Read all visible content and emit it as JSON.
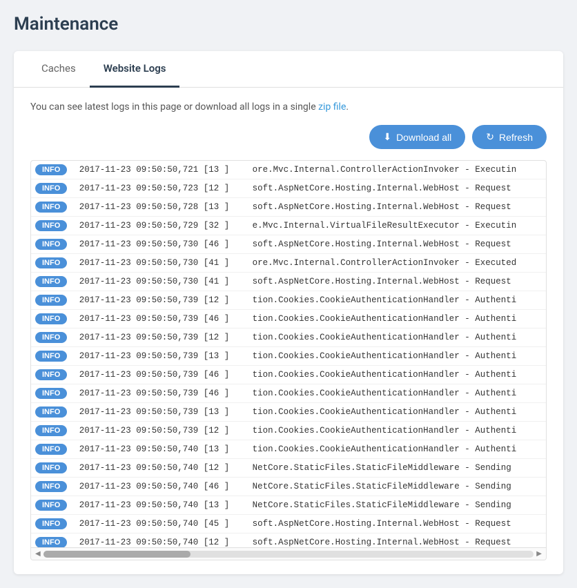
{
  "page": {
    "title": "Maintenance"
  },
  "tabs": [
    {
      "id": "caches",
      "label": "Caches",
      "active": false
    },
    {
      "id": "website-logs",
      "label": "Website Logs",
      "active": true
    }
  ],
  "info_text": "You can see latest logs in this page or download all logs in a single zip file.",
  "info_link": "zip file",
  "toolbar": {
    "download_all_label": "Download all",
    "refresh_label": "Refresh"
  },
  "logs": [
    {
      "level": "INFO",
      "timestamp": "2017-11-23 09:50:50,721",
      "thread": "[13 ]",
      "message": "ore.Mvc.Internal.ControllerActionInvoker - Executin"
    },
    {
      "level": "INFO",
      "timestamp": "2017-11-23 09:50:50,723",
      "thread": "[12 ]",
      "message": "soft.AspNetCore.Hosting.Internal.WebHost - Request"
    },
    {
      "level": "INFO",
      "timestamp": "2017-11-23 09:50:50,728",
      "thread": "[13 ]",
      "message": "soft.AspNetCore.Hosting.Internal.WebHost - Request"
    },
    {
      "level": "INFO",
      "timestamp": "2017-11-23 09:50:50,729",
      "thread": "[32 ]",
      "message": "e.Mvc.Internal.VirtualFileResultExecutor - Executin"
    },
    {
      "level": "INFO",
      "timestamp": "2017-11-23 09:50:50,730",
      "thread": "[46 ]",
      "message": "soft.AspNetCore.Hosting.Internal.WebHost - Request"
    },
    {
      "level": "INFO",
      "timestamp": "2017-11-23 09:50:50,730",
      "thread": "[41 ]",
      "message": "ore.Mvc.Internal.ControllerActionInvoker - Executed"
    },
    {
      "level": "INFO",
      "timestamp": "2017-11-23 09:50:50,730",
      "thread": "[41 ]",
      "message": "soft.AspNetCore.Hosting.Internal.WebHost - Request"
    },
    {
      "level": "INFO",
      "timestamp": "2017-11-23 09:50:50,739",
      "thread": "[12 ]",
      "message": "tion.Cookies.CookieAuthenticationHandler - Authenti"
    },
    {
      "level": "INFO",
      "timestamp": "2017-11-23 09:50:50,739",
      "thread": "[46 ]",
      "message": "tion.Cookies.CookieAuthenticationHandler - Authenti"
    },
    {
      "level": "INFO",
      "timestamp": "2017-11-23 09:50:50,739",
      "thread": "[12 ]",
      "message": "tion.Cookies.CookieAuthenticationHandler - Authenti"
    },
    {
      "level": "INFO",
      "timestamp": "2017-11-23 09:50:50,739",
      "thread": "[13 ]",
      "message": "tion.Cookies.CookieAuthenticationHandler - Authenti"
    },
    {
      "level": "INFO",
      "timestamp": "2017-11-23 09:50:50,739",
      "thread": "[46 ]",
      "message": "tion.Cookies.CookieAuthenticationHandler - Authenti"
    },
    {
      "level": "INFO",
      "timestamp": "2017-11-23 09:50:50,739",
      "thread": "[46 ]",
      "message": "tion.Cookies.CookieAuthenticationHandler - Authenti"
    },
    {
      "level": "INFO",
      "timestamp": "2017-11-23 09:50:50,739",
      "thread": "[13 ]",
      "message": "tion.Cookies.CookieAuthenticationHandler - Authenti"
    },
    {
      "level": "INFO",
      "timestamp": "2017-11-23 09:50:50,739",
      "thread": "[12 ]",
      "message": "tion.Cookies.CookieAuthenticationHandler - Authenti"
    },
    {
      "level": "INFO",
      "timestamp": "2017-11-23 09:50:50,740",
      "thread": "[13 ]",
      "message": "tion.Cookies.CookieAuthenticationHandler - Authenti"
    },
    {
      "level": "INFO",
      "timestamp": "2017-11-23 09:50:50,740",
      "thread": "[12 ]",
      "message": "NetCore.StaticFiles.StaticFileMiddleware - Sending"
    },
    {
      "level": "INFO",
      "timestamp": "2017-11-23 09:50:50,740",
      "thread": "[46 ]",
      "message": "NetCore.StaticFiles.StaticFileMiddleware - Sending"
    },
    {
      "level": "INFO",
      "timestamp": "2017-11-23 09:50:50,740",
      "thread": "[13 ]",
      "message": "NetCore.StaticFiles.StaticFileMiddleware - Sending"
    },
    {
      "level": "INFO",
      "timestamp": "2017-11-23 09:50:50,740",
      "thread": "[45 ]",
      "message": "soft.AspNetCore.Hosting.Internal.WebHost - Request"
    },
    {
      "level": "INFO",
      "timestamp": "2017-11-23 09:50:50,740",
      "thread": "[12 ]",
      "message": "soft.AspNetCore.Hosting.Internal.WebHost - Request"
    }
  ],
  "scrollbar": {
    "left_arrow": "◀",
    "right_arrow": "▶",
    "up_arrow": "▲",
    "down_arrow": "▼"
  }
}
